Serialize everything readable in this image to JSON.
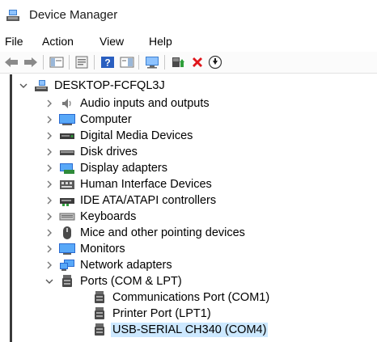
{
  "window": {
    "title": "Device Manager"
  },
  "menu": [
    "File",
    "Action",
    "View",
    "Help"
  ],
  "tree": {
    "root": "DESKTOP-FCFQL3J",
    "categories": [
      "Audio inputs and outputs",
      "Computer",
      "Digital Media Devices",
      "Disk drives",
      "Display adapters",
      "Human Interface Devices",
      "IDE ATA/ATAPI controllers",
      "Keyboards",
      "Mice and other pointing devices",
      "Monitors",
      "Network adapters",
      "Ports (COM & LPT)"
    ],
    "ports_children": [
      "Communications Port (COM1)",
      "Printer Port (LPT1)",
      "USB-SERIAL CH340 (COM4)"
    ],
    "selected": "USB-SERIAL CH340 (COM4)"
  }
}
